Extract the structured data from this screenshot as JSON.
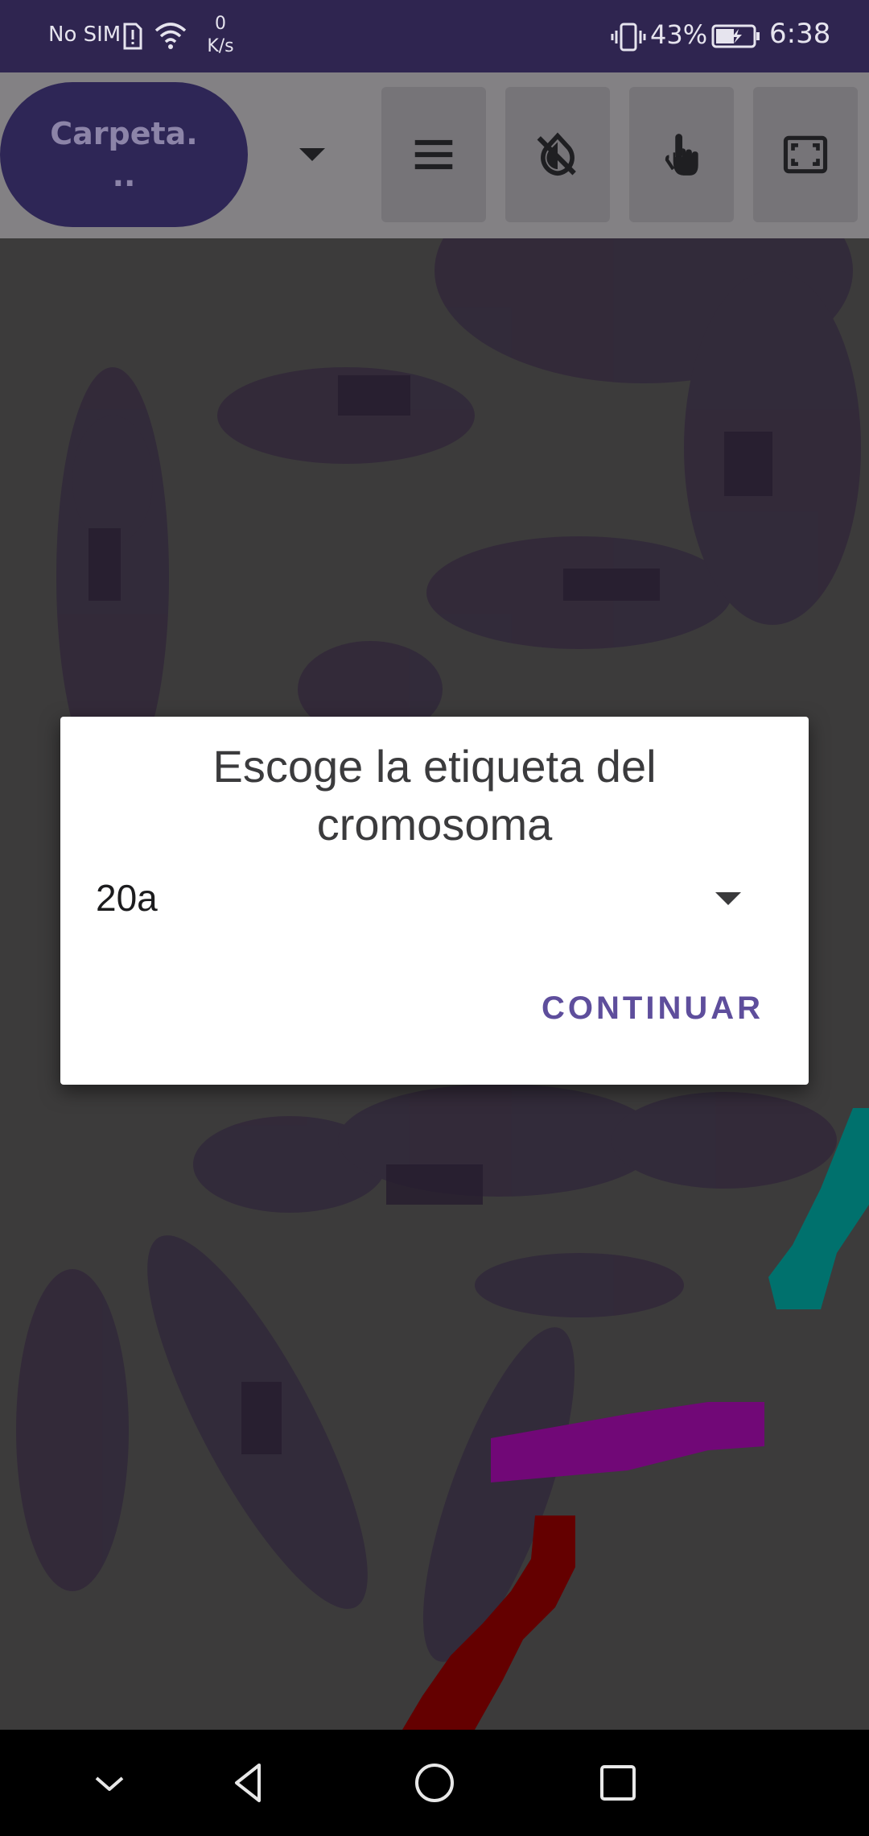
{
  "status_bar": {
    "sim_text": "No SIM",
    "speed_value": "0",
    "speed_unit": "K/s",
    "battery_percent": "43%",
    "time": "6:38",
    "icons": [
      "sim-alert-icon",
      "wifi-icon",
      "vibrate-icon",
      "battery-charging-icon"
    ]
  },
  "toolbar": {
    "folder_line1": "Carpeta.",
    "folder_line2": "..",
    "buttons": [
      "menu-icon",
      "invert-colors-off-icon",
      "touch-icon",
      "fullscreen-icon"
    ]
  },
  "dialog": {
    "title": "Escoge la etiqueta del cromosoma",
    "selected_label": "20a",
    "continue_label": "CONTINUAR"
  },
  "nav_bar": {
    "icons": [
      "hide-keyboard-icon",
      "back-icon",
      "home-icon",
      "recents-icon"
    ]
  },
  "colors": {
    "status_bar_bg": "#2f2550",
    "folder_button_bg": "#2e2656",
    "accent": "#5e4e9c",
    "annotation_teal": "#008a86",
    "annotation_magenta": "#8a0a92",
    "annotation_red": "#7a0000"
  }
}
